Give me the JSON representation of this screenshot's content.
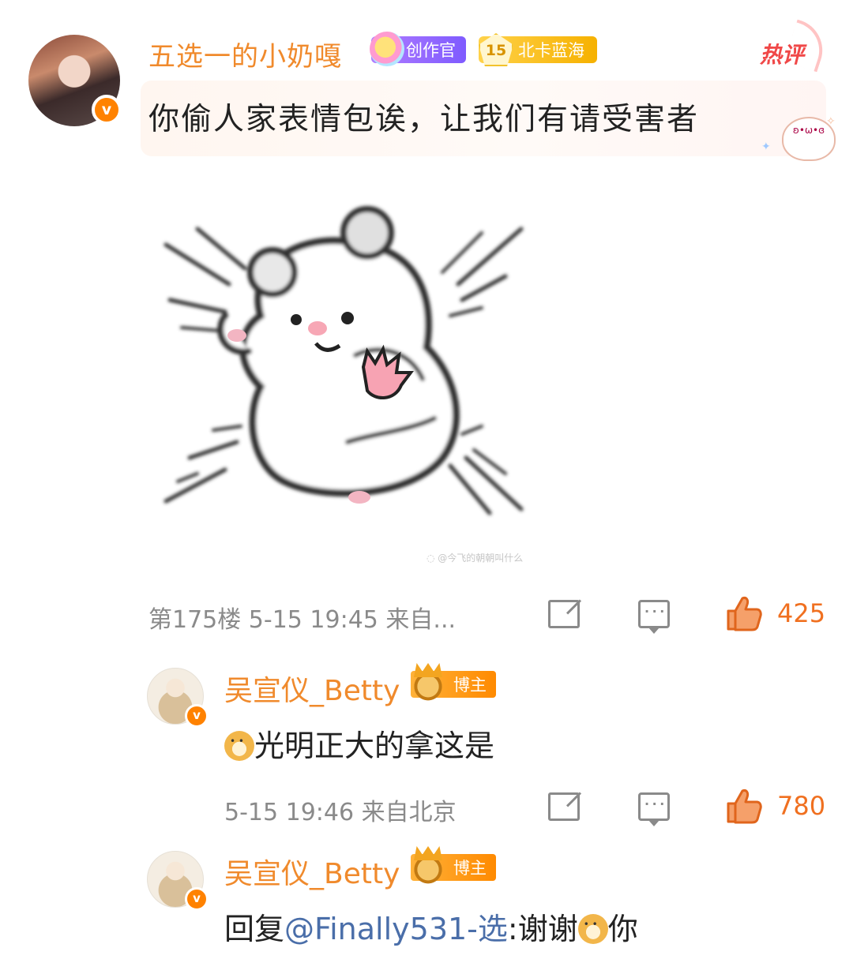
{
  "main_comment": {
    "username": "五选一的小奶嘎",
    "badges": {
      "creator": "创作官",
      "level": "15",
      "level_label": "北卡蓝海"
    },
    "hot_label": "热评",
    "text": "你偷人家表情包诶，让我们有请受害者",
    "floor_time_source": "第175楼 5-15 19:45 来自...",
    "like_count": "425"
  },
  "replies": [
    {
      "username": "吴宣仪_Betty",
      "badge": "博主",
      "text": "光明正大的拿这是",
      "time_source": "5-15 19:46 来自北京",
      "like_count": "780"
    },
    {
      "username": "吴宣仪_Betty",
      "badge": "博主",
      "text_prefix": "回复",
      "mention": "@Finally531-选",
      "text_middle": ":谢谢",
      "text_suffix": "你"
    }
  ],
  "icons": {
    "verified": "v-verified-icon",
    "share": "share-icon",
    "comment": "comment-icon",
    "like": "thumbs-up-icon",
    "emoji": "doge-emoji-icon"
  },
  "colors": {
    "username": "#f08a2c",
    "like": "#f07020",
    "meta": "#8a8a8a",
    "mention": "#4a6ea9",
    "verified": "#ff8200"
  }
}
